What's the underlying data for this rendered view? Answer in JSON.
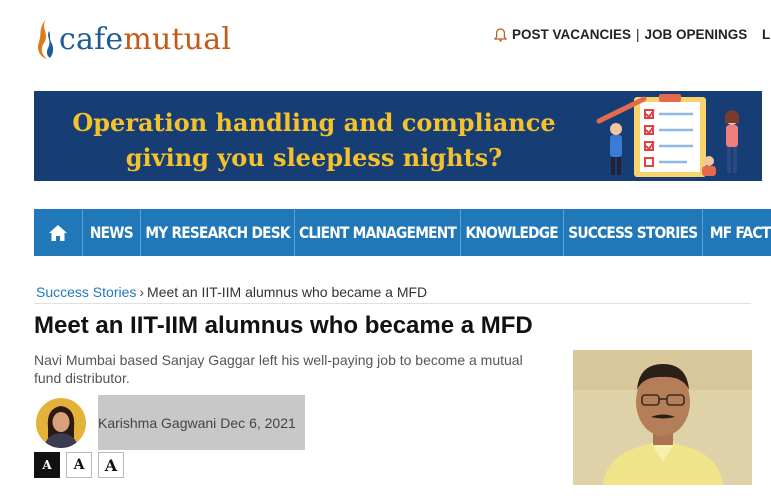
{
  "header": {
    "logo_cafe": "cafe",
    "logo_mutual": "mutual",
    "post_vacancies": "POST VACANCIES",
    "separator": "|",
    "job_openings": "JOB OPENINGS",
    "cut_link": "L",
    "icons": [
      "flame-icon",
      "bell-icon"
    ]
  },
  "banner": {
    "line1": "Operation handling and compliance",
    "line2": "giving you sleepless nights?",
    "background": "#163e75",
    "text_color": "#f5c22c"
  },
  "nav": {
    "home_icon": "home-icon",
    "items": [
      "NEWS",
      "MY RESEARCH DESK",
      "CLIENT MANAGEMENT",
      "KNOWLEDGE",
      "SUCCESS STORIES",
      "MF FACTS"
    ],
    "background": "#2178b8"
  },
  "breadcrumb": {
    "section": "Success Stories",
    "separator": "›",
    "current": "Meet an IIT-IIM alumnus who became a MFD"
  },
  "article": {
    "title": "Meet an IIT-IIM alumnus who became a MFD",
    "standfirst": "Navi Mumbai based Sanjay Gaggar left his well-paying job to become a mutual fund distributor.",
    "author": "Karishma Gagwani",
    "date": "Dec 6, 2021",
    "font_buttons": [
      "A",
      "A",
      "A"
    ]
  },
  "colors": {
    "link": "#2178b8",
    "brand_blue": "#1f5d94",
    "brand_orange": "#c55a18"
  }
}
